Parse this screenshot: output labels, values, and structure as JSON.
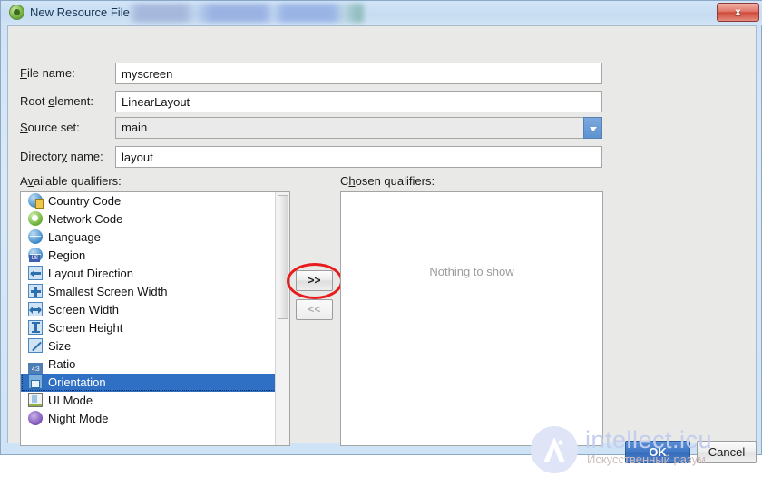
{
  "window": {
    "title": "New Resource File",
    "title_icon": "android-icon",
    "blurred_path_redacted": "",
    "close_label": "x"
  },
  "form": {
    "fields": [
      {
        "label": "File name:",
        "mnemonic": "F",
        "value": "myscreen",
        "name": "file-name",
        "readonly": false
      },
      {
        "label": "Root element:",
        "mnemonic": "e",
        "value": "LinearLayout",
        "name": "root-element",
        "readonly": false
      },
      {
        "label": "Source set:",
        "mnemonic": "S",
        "value": "main",
        "name": "source-set",
        "readonly": true
      },
      {
        "label": "Directory name:",
        "mnemonic": "y",
        "value": "layout",
        "name": "directory-name",
        "readonly": false
      }
    ]
  },
  "qualifiers": {
    "available_label": "Available qualifiers:",
    "available_mnemonic": "v",
    "chosen_label": "Chosen qualifiers:",
    "chosen_mnemonic": "h",
    "empty_text": "Nothing to show",
    "selected_index": 10,
    "available": [
      {
        "label": "Country Code",
        "icon": "globe-tag-icon"
      },
      {
        "label": "Network Code",
        "icon": "green-circle-icon"
      },
      {
        "label": "Language",
        "icon": "globe-icon"
      },
      {
        "label": "Region",
        "icon": "globe-us-icon"
      },
      {
        "label": "Layout Direction",
        "icon": "arrow-left-icon"
      },
      {
        "label": "Smallest Screen Width",
        "icon": "arrows-four-way-icon"
      },
      {
        "label": "Screen Width",
        "icon": "arrows-horizontal-icon"
      },
      {
        "label": "Screen Height",
        "icon": "arrows-vertical-icon"
      },
      {
        "label": "Size",
        "icon": "arrow-diagonal-icon"
      },
      {
        "label": "Ratio",
        "icon": "ratio-43-icon"
      },
      {
        "label": "Orientation",
        "icon": "monitor-icon"
      },
      {
        "label": "UI Mode",
        "icon": "ui-mode-icon"
      },
      {
        "label": "Night Mode",
        "icon": "night-mode-icon"
      }
    ],
    "chosen": []
  },
  "transfer": {
    "add_label": ">>",
    "add_enabled": true,
    "remove_label": "<<",
    "remove_enabled": false,
    "annotation_color": "#e81c1c"
  },
  "footer": {
    "ok_label": "OK",
    "cancel_label": "Cancel",
    "ok_accent": "#3f77c6"
  },
  "watermark": {
    "logo_text": "Ai",
    "title": "intellect.icu",
    "subtitle": "Искусственный разум"
  }
}
